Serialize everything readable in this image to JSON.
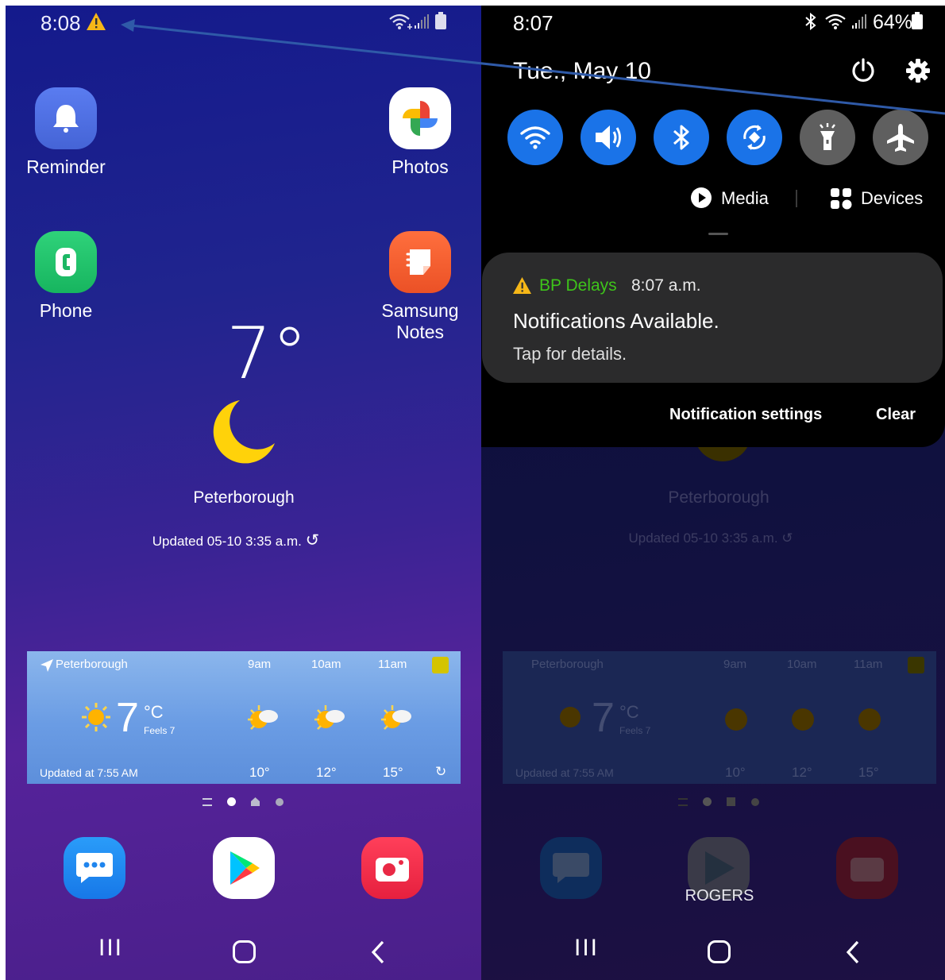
{
  "left": {
    "status": {
      "time": "8:08"
    },
    "apps": {
      "reminder": "Reminder",
      "photos": "Photos",
      "phone": "Phone",
      "samsung_notes": "Samsung\nNotes"
    },
    "weather_clock": {
      "temp": "7°",
      "city": "Peterborough",
      "updated": "Updated 05-10 3:35 a.m."
    },
    "forecast": {
      "location": "Peterborough",
      "hours": [
        "9am",
        "10am",
        "11am"
      ],
      "temp": "7",
      "unit": "°C",
      "feels": "Feels 7",
      "hour_temps": [
        "10°",
        "12°",
        "15°"
      ],
      "updated": "Updated at 7:55 AM"
    }
  },
  "right": {
    "status": {
      "time": "8:07",
      "battery": "64%"
    },
    "date": "Tue., May 10",
    "quick_tiles": [
      {
        "name": "wifi",
        "active": true
      },
      {
        "name": "sound",
        "active": true
      },
      {
        "name": "bluetooth",
        "active": true
      },
      {
        "name": "auto-rotate",
        "active": true
      },
      {
        "name": "flashlight",
        "active": false
      },
      {
        "name": "airplane",
        "active": false
      }
    ],
    "media_label": "Media",
    "devices_label": "Devices",
    "notification": {
      "app": "BP Delays",
      "time": "8:07 a.m.",
      "title": "Notifications Available.",
      "body": "Tap for details."
    },
    "notification_settings": "Notification settings",
    "clear": "Clear",
    "carrier": "ROGERS",
    "bg": {
      "city": "Peterborough",
      "updated": "Updated 05-10 3:35 a.m.",
      "location": "Peterborough",
      "hours": [
        "9am",
        "10am",
        "11am"
      ],
      "temp": "7",
      "unit": "°C",
      "feels": "Feels 7",
      "hour_temps": [
        "10°",
        "12°",
        "15°"
      ],
      "fupdated": "Updated at 7:55 AM"
    }
  },
  "colors": {
    "accent_blue": "#1a73e8",
    "notif_app_green": "#3ec41a",
    "arrow": "#2f5aa8"
  }
}
